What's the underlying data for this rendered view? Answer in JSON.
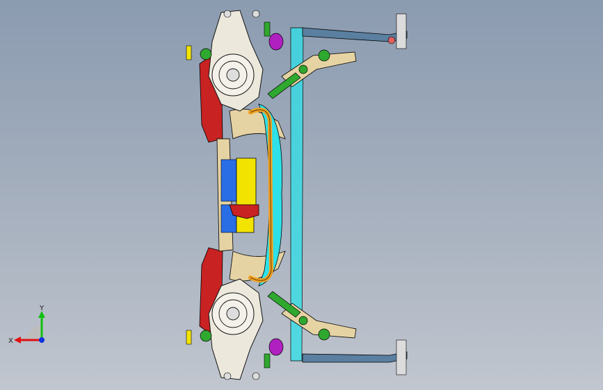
{
  "viewport": {
    "description_none": "",
    "triad": {
      "x_label": "X",
      "y_label": "Y",
      "x_color": "#e01010",
      "y_color": "#10c010",
      "z_color": "#1030e0"
    }
  },
  "colors": {
    "background_top": "#8b9bb0",
    "background_bottom": "#c1c6cf",
    "knuckle": "#e8e4d6",
    "subframe_tan": "#e6d3a3",
    "cyan_member": "#2ee0e8",
    "yellow_plate": "#f2e400",
    "red_part": "#d02020",
    "green_link": "#2fa82f",
    "blue_plate": "#2060e0",
    "orange_bar": "#f0a020",
    "magenta_bushing": "#b020c0"
  }
}
